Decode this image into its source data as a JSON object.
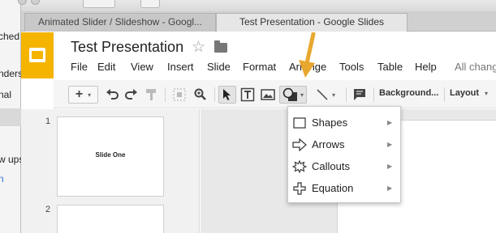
{
  "background_window": {
    "lines": [
      "ched",
      "nders",
      "nal",
      "w ups",
      "n"
    ]
  },
  "browser": {
    "tabs": [
      {
        "label": "Animated Slider / Slideshow - Googl...",
        "active": false
      },
      {
        "label": "Test Presentation - Google Slides",
        "active": true
      }
    ]
  },
  "document": {
    "title": "Test Presentation"
  },
  "menubar": {
    "items": [
      "File",
      "Edit",
      "View",
      "Insert",
      "Slide",
      "Format",
      "Arrange",
      "Tools",
      "Table",
      "Help"
    ],
    "status": "All chang"
  },
  "toolbar": {
    "background_label": "Background...",
    "layout_label": "Layout",
    "icons": [
      "new-slide-icon",
      "undo-icon",
      "redo-icon",
      "paint-format-icon",
      "select-icon",
      "zoom-icon",
      "cursor-icon",
      "text-box-icon",
      "image-icon",
      "shape-icon",
      "line-icon",
      "comment-icon"
    ]
  },
  "filmstrip": {
    "slides": [
      {
        "number": "1",
        "label": "Slide One"
      },
      {
        "number": "2",
        "label": ""
      }
    ]
  },
  "shape_menu": {
    "items": [
      {
        "label": "Shapes",
        "icon": "rectangle-icon"
      },
      {
        "label": "Arrows",
        "icon": "arrow-shape-icon"
      },
      {
        "label": "Callouts",
        "icon": "callout-burst-icon"
      },
      {
        "label": "Equation",
        "icon": "plus-shape-icon"
      }
    ]
  },
  "colors": {
    "logo": "#f4b400",
    "annotation_arrow": "#e8a72f"
  }
}
